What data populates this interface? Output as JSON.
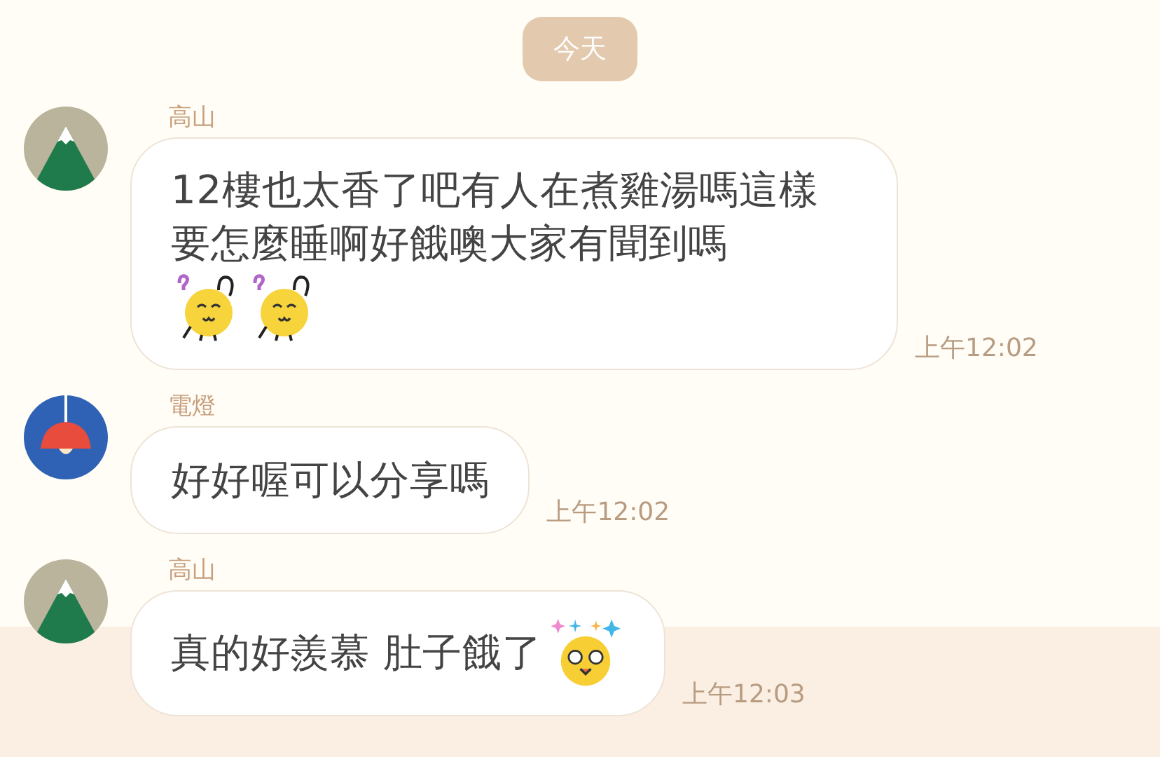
{
  "date_divider": "今天",
  "messages": [
    {
      "sender": "高山",
      "avatar": {
        "kind": "mountain"
      },
      "text": "12樓也太香了吧有人在煮雞湯嗎這樣要怎麼睡啊好餓噢大家有聞到嗎",
      "stickers": [
        {
          "kind": "confused"
        },
        {
          "kind": "confused"
        }
      ],
      "time": "上午12:02",
      "highlighted": false
    },
    {
      "sender": "電燈",
      "avatar": {
        "kind": "lamp"
      },
      "text": "好好喔可以分享嗎",
      "time": "上午12:02",
      "highlighted": false
    },
    {
      "sender": "高山",
      "avatar": {
        "kind": "mountain"
      },
      "text": "真的好羨慕 肚子餓了",
      "stickers": [
        {
          "kind": "starry"
        }
      ],
      "time": "上午12:03",
      "highlighted": true
    }
  ]
}
